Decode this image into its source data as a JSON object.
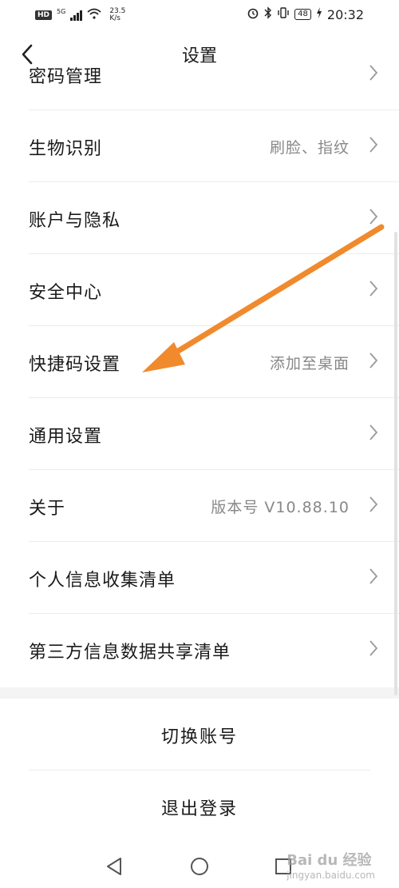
{
  "status_bar": {
    "hd": "HD",
    "network": "5G",
    "speed_value": "23.5",
    "speed_unit": "K/s",
    "battery": "48",
    "time": "20:32"
  },
  "header": {
    "title": "设置"
  },
  "settings": [
    {
      "label": "密码管理",
      "value": ""
    },
    {
      "label": "生物识别",
      "value": "刷脸、指纹"
    },
    {
      "label": "账户与隐私",
      "value": ""
    },
    {
      "label": "安全中心",
      "value": ""
    },
    {
      "label": "快捷码设置",
      "value": "添加至桌面"
    },
    {
      "label": "通用设置",
      "value": ""
    },
    {
      "label": "关于",
      "value": "版本号 V10.88.10"
    },
    {
      "label": "个人信息收集清单",
      "value": ""
    },
    {
      "label": "第三方信息数据共享清单",
      "value": ""
    }
  ],
  "actions": {
    "switch_account": "切换账号",
    "logout": "退出登录"
  },
  "watermark": {
    "brand": "Bai du 经验",
    "site": "jingyan.baidu.com"
  },
  "colors": {
    "annotation_arrow": "#f08a2c",
    "divider": "#ececec",
    "value_text": "#888888"
  }
}
